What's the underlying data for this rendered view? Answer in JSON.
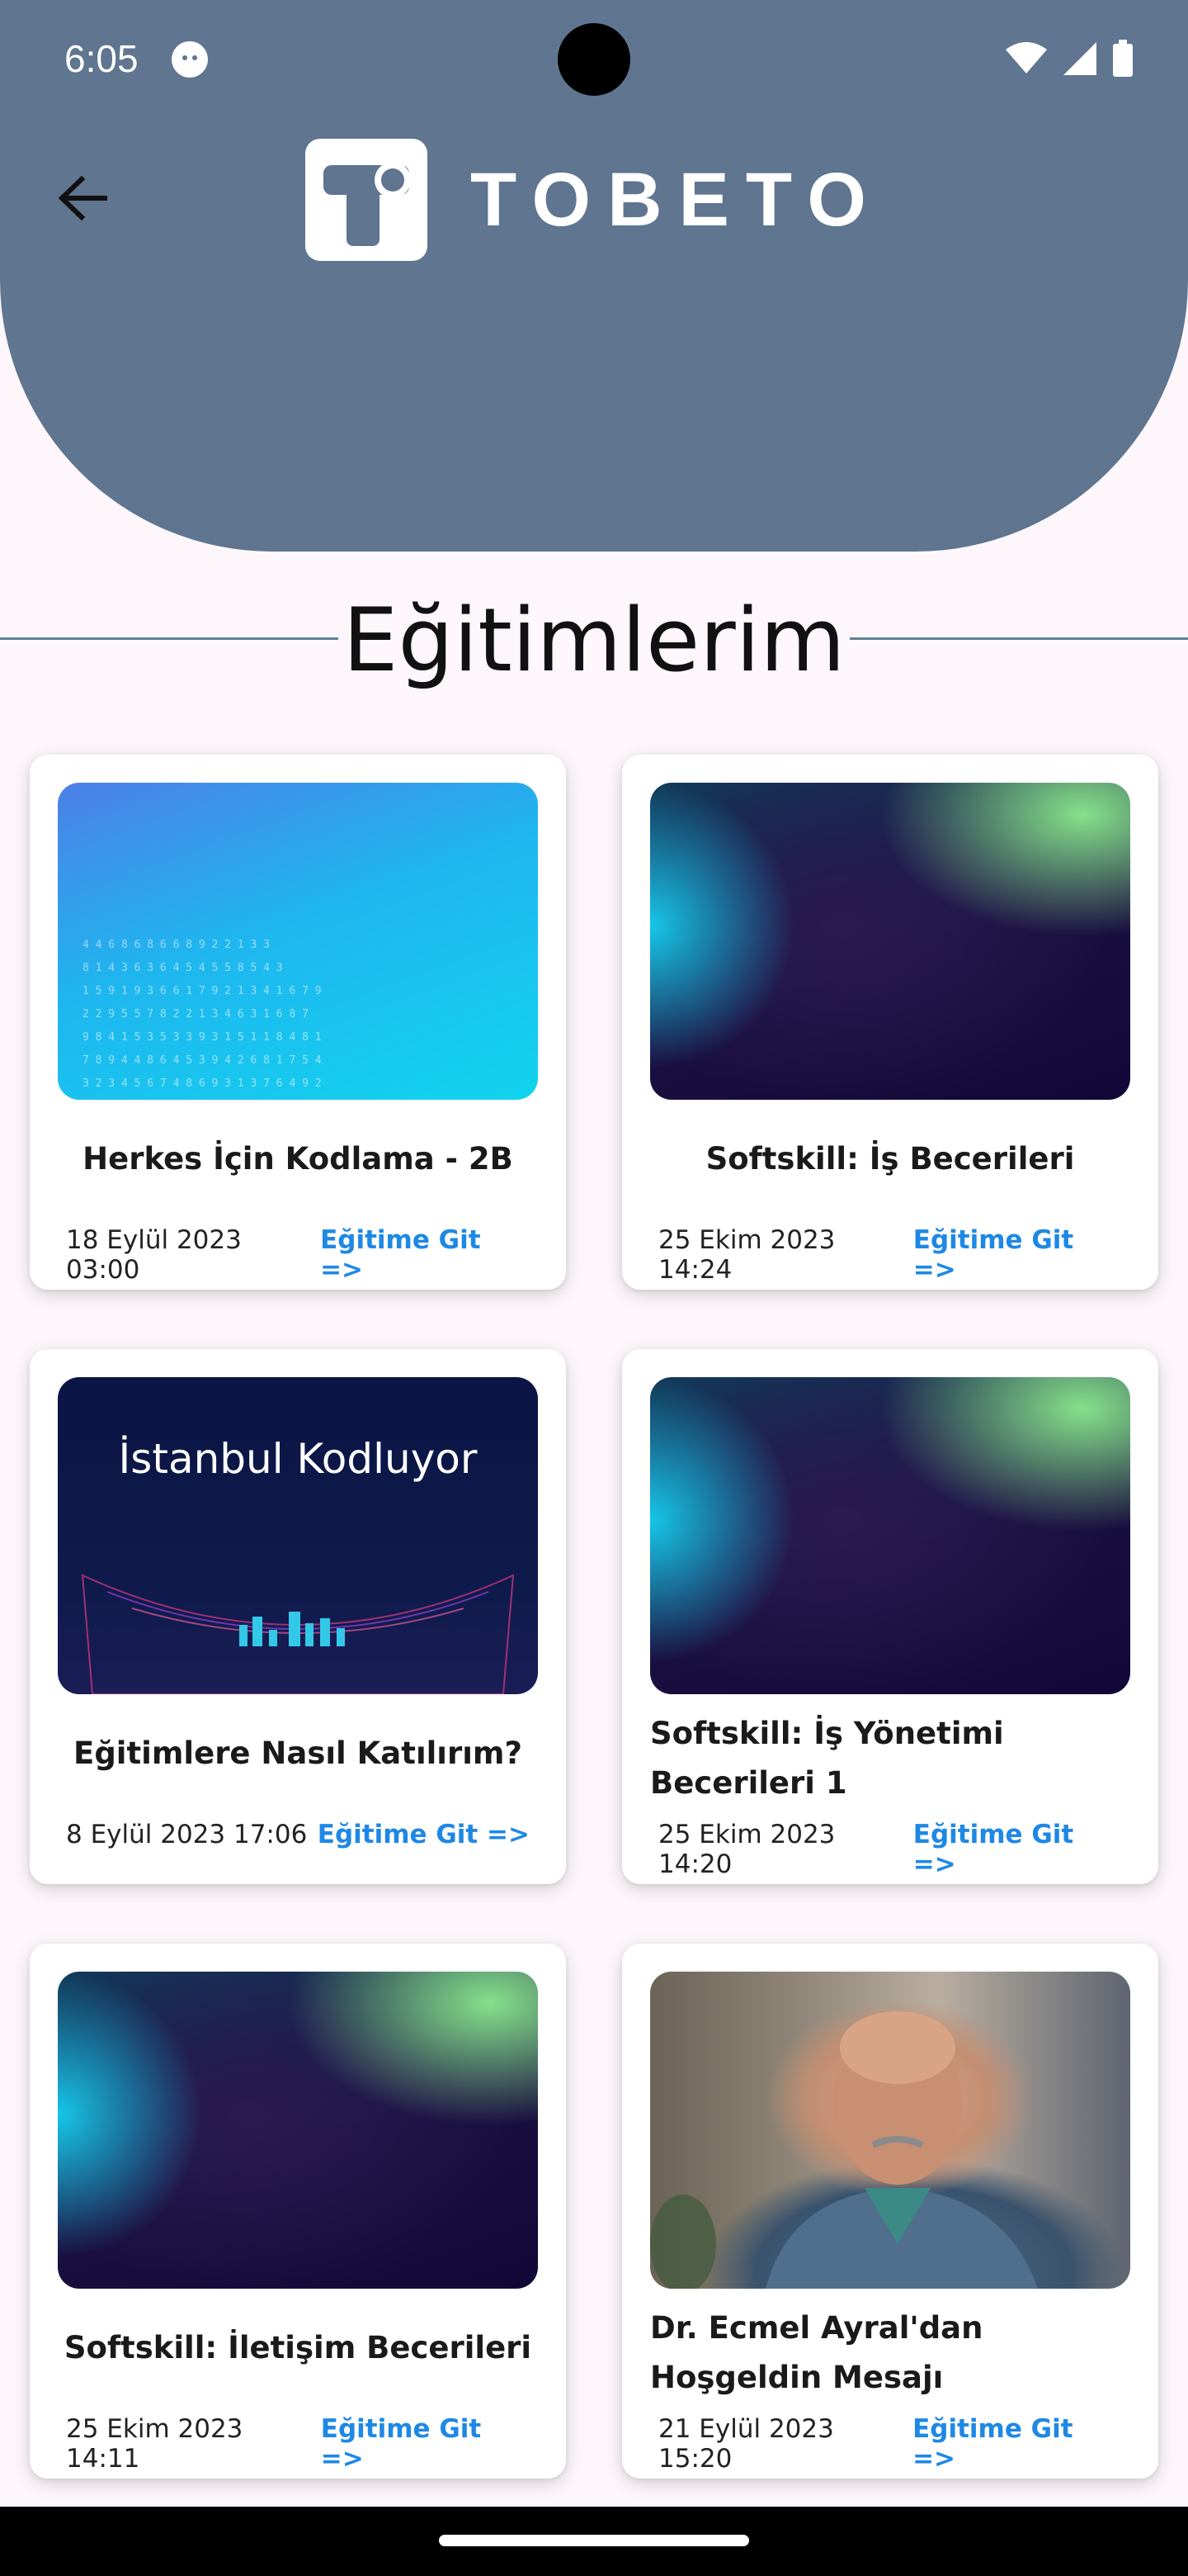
{
  "status_bar": {
    "time": "6:05"
  },
  "header": {
    "brand": "TOBETO",
    "back_icon": "arrow-left-icon",
    "background_color": "#5f7590"
  },
  "section": {
    "title": "Eğitimlerim"
  },
  "cards": [
    {
      "title": "Herkes İçin Kodlama - 2B",
      "date": "18 Eylül 2023 03:00",
      "link": "Eğitime Git =>",
      "thumbnail": "blue-code-gradient"
    },
    {
      "title": "Softskill: İş Becerileri",
      "date": "25 Ekim 2023 14:24",
      "link": "Eğitime Git =>",
      "thumbnail": "dark-aurora-gradient"
    },
    {
      "title": "Eğitimlere Nasıl Katılırım?",
      "date": "8 Eylül 2023 17:06",
      "link": "Eğitime Git =>",
      "thumbnail": "istanbul-kodluyor",
      "thumbnail_text": "İstanbul Kodluyor"
    },
    {
      "title": "Softskill: İş Yönetimi Becerileri 1",
      "date": "25 Ekim 2023 14:20",
      "link": "Eğitime Git =>",
      "thumbnail": "dark-aurora-gradient"
    },
    {
      "title": "Softskill: İletişim Becerileri",
      "date": "25 Ekim 2023 14:11",
      "link": "Eğitime Git =>",
      "thumbnail": "dark-aurora-gradient"
    },
    {
      "title": "Dr. Ecmel Ayral'dan Hoşgeldin Mesajı",
      "date": "21 Eylül 2023 15:20",
      "link": "Eğitime Git =>",
      "thumbnail": "speaker-photo"
    }
  ],
  "colors": {
    "link": "#1e88e5",
    "page_background": "#fdf7fb",
    "divider": "#5f8298"
  }
}
